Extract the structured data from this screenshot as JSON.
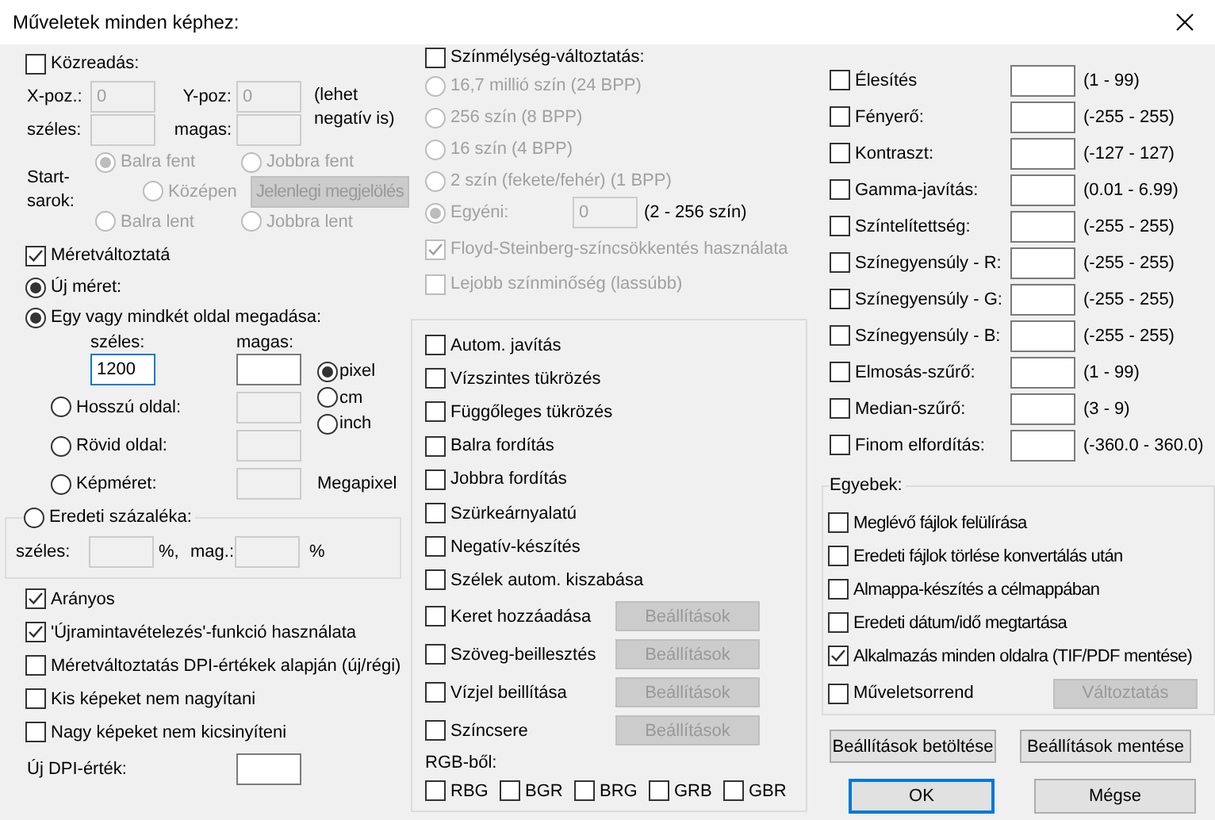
{
  "window": {
    "title": "Műveletek minden képhez:"
  },
  "overlay": {
    "label": "Közreadás:",
    "checked": false,
    "disabled": true,
    "x_label": "X-poz.:",
    "x_value": "0",
    "y_label": "Y-poz:",
    "y_value": "0",
    "note": "(lehet negatív is)",
    "width_label": "széles:",
    "height_label": "magas:",
    "corner_label": "Start-sarok:",
    "current_button": "Jelenlegi megjelölés",
    "corners": [
      {
        "label": "Balra fent",
        "selected": true
      },
      {
        "label": "Jobbra fent",
        "selected": false
      },
      {
        "label": "Középen",
        "selected": false
      },
      {
        "label": "Balra lent",
        "selected": false
      },
      {
        "label": "Jobbra lent",
        "selected": false
      }
    ]
  },
  "resize": {
    "label": "Méretváltoztatá",
    "checked": true,
    "new_size": {
      "label": "Új méret:",
      "selected": true
    },
    "one_or_both": {
      "label": "Egy vagy mindkét oldal megadása:",
      "selected": true,
      "width_label": "széles:",
      "width_value": "1200",
      "width_focused": true,
      "height_label": "magas:"
    },
    "sides": [
      {
        "label": "Hosszú oldal:",
        "selected": false
      },
      {
        "label": "Rövid oldal:",
        "selected": false
      },
      {
        "label": "Képméret:",
        "selected": false
      }
    ],
    "megapixel_unit": "Megapixel",
    "units": [
      {
        "label": "pixel",
        "selected": true
      },
      {
        "label": "cm",
        "selected": false
      },
      {
        "label": "inch",
        "selected": false
      }
    ],
    "percent": {
      "label": "Eredeti százaléka:",
      "selected": false,
      "width_label": "széles:",
      "width_unit": "%,",
      "height_label": "mag.:",
      "height_unit": "%"
    }
  },
  "resize_options": [
    {
      "label": "Arányos",
      "checked": true
    },
    {
      "label": "'Újramintavételezés'-funkció használata",
      "checked": true
    },
    {
      "label": "Méretváltoztatás DPI-értékek alapján (új/régi)",
      "checked": false
    },
    {
      "label": "Kis képeket nem nagyítani",
      "checked": false
    },
    {
      "label": "Nagy képeket nem kicsinyíteni",
      "checked": false
    }
  ],
  "dpi": {
    "label": "Új DPI-érték:"
  },
  "color_depth": {
    "label": "Színmélység-változtatás:",
    "checked": false,
    "disabled": true,
    "options": [
      {
        "label": "16,7 millió szín (24 BPP)",
        "selected": false
      },
      {
        "label": "256 szín (8 BPP)",
        "selected": false
      },
      {
        "label": "16 szín (4 BPP)",
        "selected": false
      },
      {
        "label": "2 szín (fekete/fehér) (1 BPP)",
        "selected": false
      },
      {
        "label": "Egyéni:",
        "selected": true
      }
    ],
    "custom_value": "0",
    "custom_range": "(2 - 256 szín)",
    "checks": [
      {
        "label": "Floyd-Steinberg-színcsökkentés használata",
        "checked": true
      },
      {
        "label": "Lejobb színminőség (lassúbb)",
        "checked": false
      }
    ]
  },
  "operations": [
    {
      "label": "Autom. javítás",
      "checked": false
    },
    {
      "label": "Vízszintes tükrözés",
      "checked": false
    },
    {
      "label": "Függőleges tükrözés",
      "checked": false
    },
    {
      "label": "Balra fordítás",
      "checked": false
    },
    {
      "label": "Jobbra fordítás",
      "checked": false
    },
    {
      "label": "Szürkeárnyalatú",
      "checked": false
    },
    {
      "label": "Negatív-készítés",
      "checked": false
    },
    {
      "label": "Szélek autom. kiszabása",
      "checked": false
    },
    {
      "label": "Keret hozzáadása",
      "checked": false,
      "button": "Beállítások"
    },
    {
      "label": "Szöveg-beillesztés",
      "checked": false,
      "button": "Beállítások"
    },
    {
      "label": "Vízjel beillítása",
      "checked": false,
      "button": "Beállítások"
    },
    {
      "label": "Színcsere",
      "checked": false,
      "button": "Beállítások"
    }
  ],
  "rgb": {
    "label": "RGB-ből:",
    "options": [
      {
        "label": "RBG",
        "checked": false
      },
      {
        "label": "BGR",
        "checked": false
      },
      {
        "label": "BRG",
        "checked": false
      },
      {
        "label": "GRB",
        "checked": false
      },
      {
        "label": "GBR",
        "checked": false
      }
    ]
  },
  "adjustments": [
    {
      "label": "Élesítés",
      "range": "(1  -  99)",
      "checked": false
    },
    {
      "label": "Fényerő:",
      "range": "(-255  -  255)",
      "checked": false
    },
    {
      "label": "Kontraszt:",
      "range": "(-127  -  127)",
      "checked": false
    },
    {
      "label": "Gamma-javítás:",
      "range": "(0.01  -  6.99)",
      "checked": false
    },
    {
      "label": "Színtelítettség:",
      "range": "(-255  -  255)",
      "checked": false
    },
    {
      "label": "Színegyensúly - R:",
      "range": "(-255  -  255)",
      "checked": false
    },
    {
      "label": "Színegyensúly - G:",
      "range": "(-255  -  255)",
      "checked": false
    },
    {
      "label": "Színegyensúly - B:",
      "range": "(-255  -  255)",
      "checked": false
    },
    {
      "label": "Elmosás-szűrő:",
      "range": "(1  -  99)",
      "checked": false
    },
    {
      "label": "Median-szűrő:",
      "range": "(3  -  9)",
      "checked": false
    },
    {
      "label": "Finom elfordítás:",
      "range": "(-360.0  -  360.0)",
      "checked": false
    }
  ],
  "misc": {
    "title": "Egyebek:",
    "options": [
      {
        "label": "Meglévő fájlok felülírása",
        "checked": false
      },
      {
        "label": "Eredeti fájlok törlése konvertálás után",
        "checked": false
      },
      {
        "label": "Almappa-készítés a célmappában",
        "checked": false
      },
      {
        "label": "Eredeti dátum/idő megtartása",
        "checked": false
      },
      {
        "label": "Alkalmazás minden oldalra (TIF/PDF mentése)",
        "checked": true
      }
    ],
    "order": {
      "label": "Műveletsorrend",
      "checked": false,
      "button": "Változtatás"
    }
  },
  "settings_buttons": [
    "Beállítások betöltése",
    "Beállítások mentése"
  ],
  "dialog_buttons": [
    {
      "label": "OK",
      "default": true
    },
    {
      "label": "Mégse",
      "default": false
    }
  ]
}
